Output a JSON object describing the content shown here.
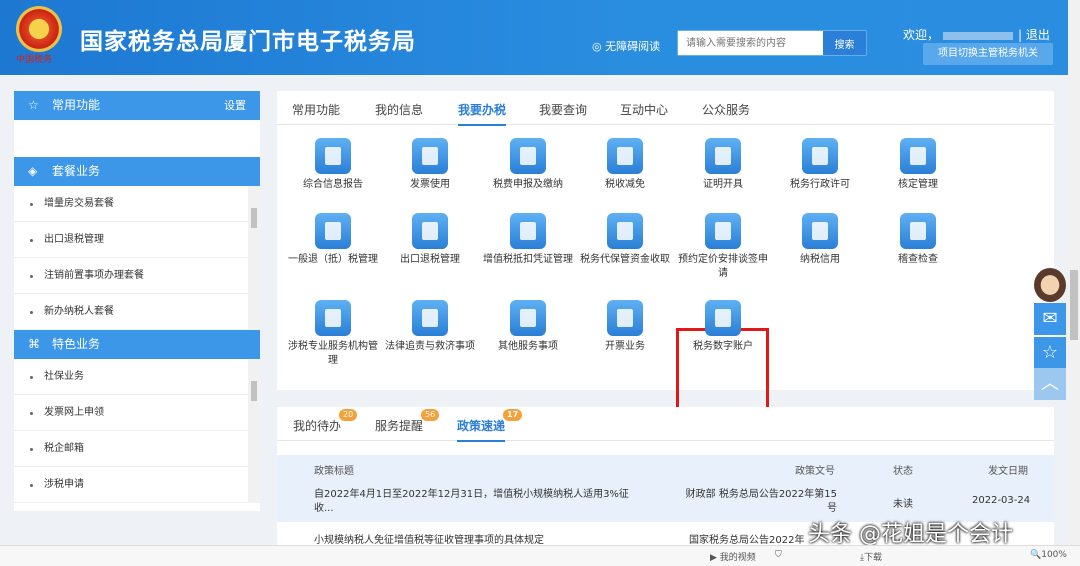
{
  "header": {
    "emblem_text": "中国税务",
    "title": "国家税务总局厦门市电子税务局",
    "accessibility": "无障碍阅读",
    "search_placeholder": "请输入需要搜索的内容",
    "search_button": "搜索",
    "welcome": "欢迎，",
    "logout": "退出",
    "switch_button": "项目切换主管税务机关"
  },
  "sidebar": {
    "common": {
      "title": "常用功能",
      "settings": "设置"
    },
    "package": {
      "title": "套餐业务",
      "items": [
        "增量房交易套餐",
        "出口退税管理",
        "注销前置事项办理套餐",
        "新办纳税人套餐"
      ]
    },
    "special": {
      "title": "特色业务",
      "items": [
        "社保业务",
        "发票网上申领",
        "税企邮箱",
        "涉税申请"
      ]
    }
  },
  "main": {
    "tabs": [
      "常用功能",
      "我的信息",
      "我要办税",
      "我要查询",
      "互动中心",
      "公众服务"
    ],
    "active_tab": "我要办税",
    "services": [
      [
        "综合信息报告",
        "发票使用",
        "税费申报及缴纳",
        "税收减免",
        "证明开具",
        "税务行政许可",
        "核定管理"
      ],
      [
        "一般退（抵）税管理",
        "出口退税管理",
        "增值税抵扣凭证管理",
        "税务代保管资金收取",
        "预约定价安排谈签申请",
        "纳税信用",
        "稽查检查"
      ],
      [
        "涉税专业服务机构管理",
        "法律追责与救济事项",
        "其他服务事项",
        "开票业务",
        "税务数字账户"
      ]
    ],
    "highlighted": "税务数字账户"
  },
  "bottom": {
    "tabs": [
      {
        "label": "我的待办",
        "badge": "20"
      },
      {
        "label": "服务提醒",
        "badge": "56"
      },
      {
        "label": "政策速递",
        "badge": "17"
      }
    ],
    "columns": [
      "政策标题",
      "政策文号",
      "状态",
      "发文日期"
    ],
    "rows": [
      {
        "title": "自2022年4月1日至2022年12月31日，增值税小规模纳税人适用3%征收...",
        "doc": "财政部 税务总局公告2022年第15号",
        "status": "未读",
        "date": "2022-03-24"
      },
      {
        "title": "小规模纳税人免征增值税等征收管理事项的具体规定",
        "doc": "国家税务总局公告2022年",
        "status": "",
        "date": ""
      }
    ]
  },
  "statusbar": {
    "video": "我的视频",
    "download": "下载",
    "zoom": "100%"
  },
  "watermark": "头条 @花姐是个会计"
}
